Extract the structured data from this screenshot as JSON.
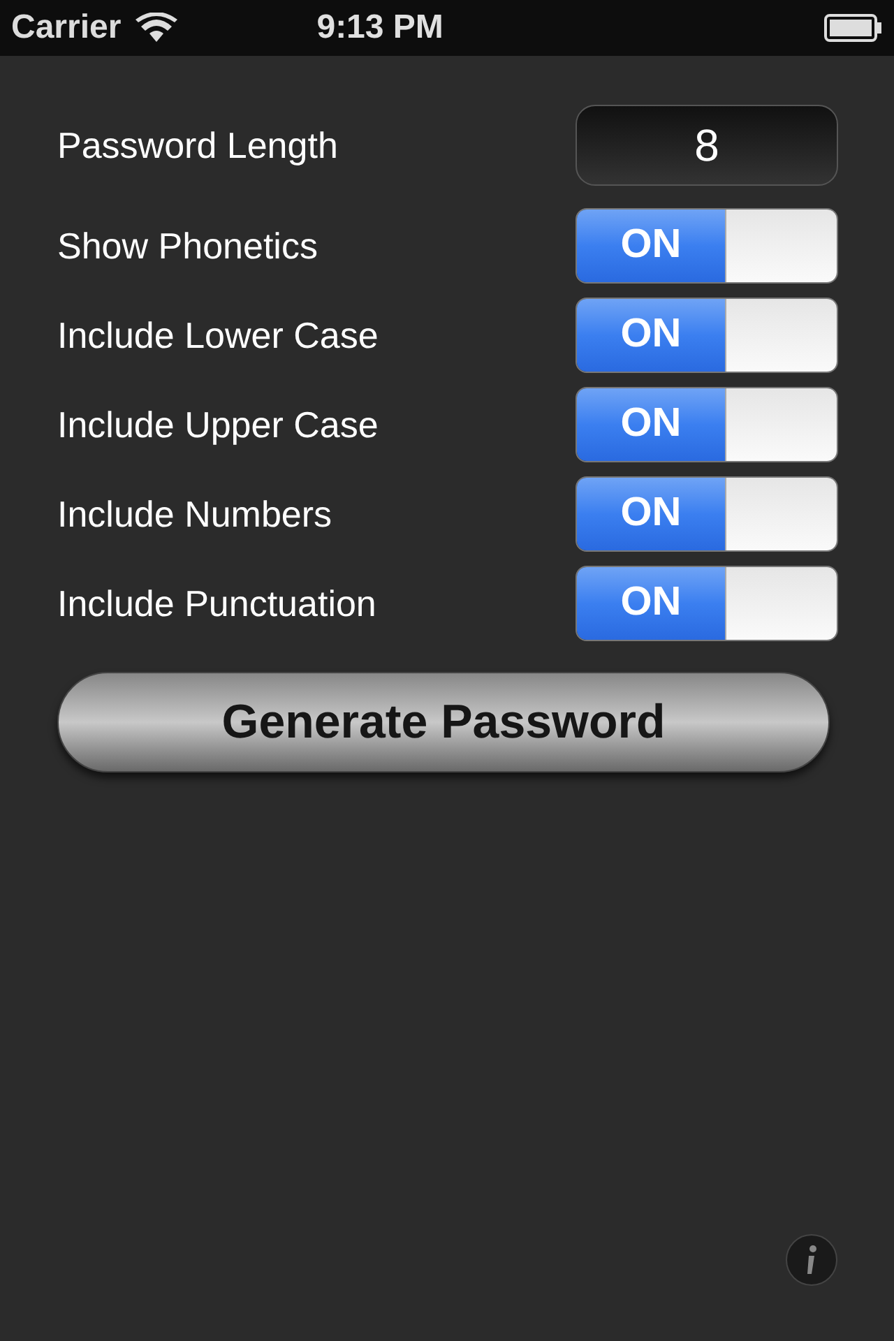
{
  "status_bar": {
    "carrier": "Carrier",
    "time": "9:13 PM"
  },
  "password_length": {
    "label": "Password Length",
    "value": "8"
  },
  "options": [
    {
      "label": "Show Phonetics",
      "on": true,
      "switch_text": "ON"
    },
    {
      "label": "Include Lower Case",
      "on": true,
      "switch_text": "ON"
    },
    {
      "label": "Include Upper Case",
      "on": true,
      "switch_text": "ON"
    },
    {
      "label": "Include Numbers",
      "on": true,
      "switch_text": "ON"
    },
    {
      "label": "Include Punctuation",
      "on": true,
      "switch_text": "ON"
    }
  ],
  "generate_button": "Generate Password"
}
